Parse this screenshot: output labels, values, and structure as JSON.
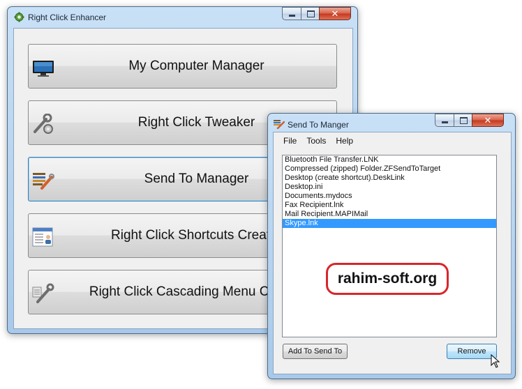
{
  "main_window": {
    "title": "Right Click Enhancer",
    "buttons": [
      {
        "label": "My Computer Manager",
        "icon": "monitor-icon"
      },
      {
        "label": "Right Click Tweaker",
        "icon": "wrench-gear-icon"
      },
      {
        "label": "Send To Manager",
        "icon": "sendto-tools-icon"
      },
      {
        "label": "Right Click Shortcuts Creator",
        "icon": "shortcut-window-icon"
      },
      {
        "label": "Right Click Cascading Menu Creator",
        "icon": "wrench-menu-icon"
      }
    ]
  },
  "sendto_window": {
    "title": "Send To Manger",
    "menu": [
      "File",
      "Tools",
      "Help"
    ],
    "items": [
      "Bluetooth File Transfer.LNK",
      "Compressed (zipped) Folder.ZFSendToTarget",
      "Desktop (create shortcut).DeskLink",
      "Desktop.ini",
      "Documents.mydocs",
      "Fax Recipient.lnk",
      "Mail Recipient.MAPIMail",
      "Skype.lnk"
    ],
    "selected_index": 7,
    "add_button": "Add To Send To",
    "remove_button": "Remove"
  },
  "watermark": "rahim-soft.org",
  "colors": {
    "selection": "#3399ff",
    "watermark_border": "#d8262c",
    "focus_border": "#3c7fb1"
  }
}
